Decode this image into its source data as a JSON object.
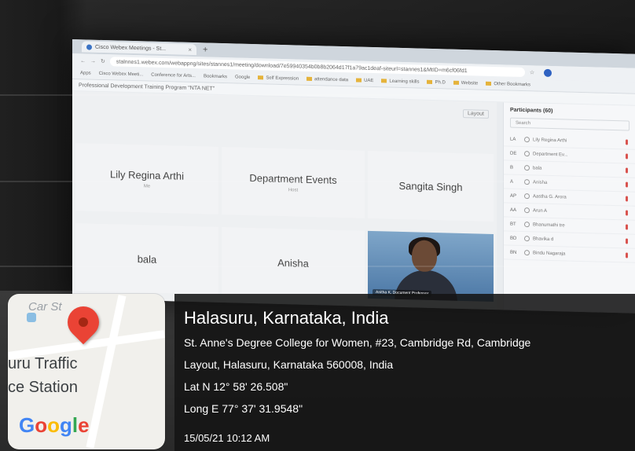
{
  "browser": {
    "tab_title": "Cisco Webex Meetings - St...",
    "url": "stalnnes1.webex.com/webappng/sites/stannes1/meeting/download/7e59940354b0b8b2064d17f1a79ac1deaf-siteurl=stannes1&MtID=m6cf06fd1",
    "bookmarks": [
      "Apps",
      "Cisco Webex Meeti...",
      "Conference for Arts...",
      "Bookmarks",
      "Google",
      "Self Expression",
      "attendance data",
      "UAE",
      "Learning skills",
      "Ph.D",
      "Website",
      "Other Bookmarks"
    ],
    "meeting_title": "Professional Development Training Program \"NTA NET\""
  },
  "stage": {
    "layout_label": "Layout",
    "tiles": [
      {
        "name": "Lily Regina Arthi",
        "sub": "Me"
      },
      {
        "name": "Department Events",
        "sub": "Host"
      },
      {
        "name": "Sangita Singh",
        "sub": ""
      },
      {
        "name": "bala",
        "sub": ""
      },
      {
        "name": "Anisha",
        "sub": ""
      }
    ],
    "video_caption": "Anitha K, Document Professor"
  },
  "participants": {
    "title": "Participants (60)",
    "search_placeholder": "Search",
    "rows": [
      {
        "initials": "LA",
        "name": "Lily Regina Arthi"
      },
      {
        "initials": "DE",
        "name": "Department Ev..."
      },
      {
        "initials": "B",
        "name": "bala"
      },
      {
        "initials": "A",
        "name": "Anisha"
      },
      {
        "initials": "AP",
        "name": "Aastha G. Arora"
      },
      {
        "initials": "AA",
        "name": "Arun A"
      },
      {
        "initials": "BT",
        "name": "Bhanumathi tre"
      },
      {
        "initials": "BD",
        "name": "Bhavika d"
      },
      {
        "initials": "BN",
        "name": "Bindu Nagaraja"
      }
    ]
  },
  "geotag": {
    "map_labels": {
      "street": "Car St",
      "place_line1": "uru Traffic",
      "place_line2": "ce Station",
      "brand": "Google"
    },
    "place": "Halasuru, Karnataka, India",
    "address_line1": "St. Anne's Degree College for Women, #23, Cambridge Rd, Cambridge",
    "address_line2": "Layout, Halasuru, Karnataka 560008, India",
    "latitude": "Lat N 12° 58' 26.508\"",
    "longitude": "Long E 77° 37' 31.9548\"",
    "timestamp": "15/05/21 10:12 AM"
  }
}
